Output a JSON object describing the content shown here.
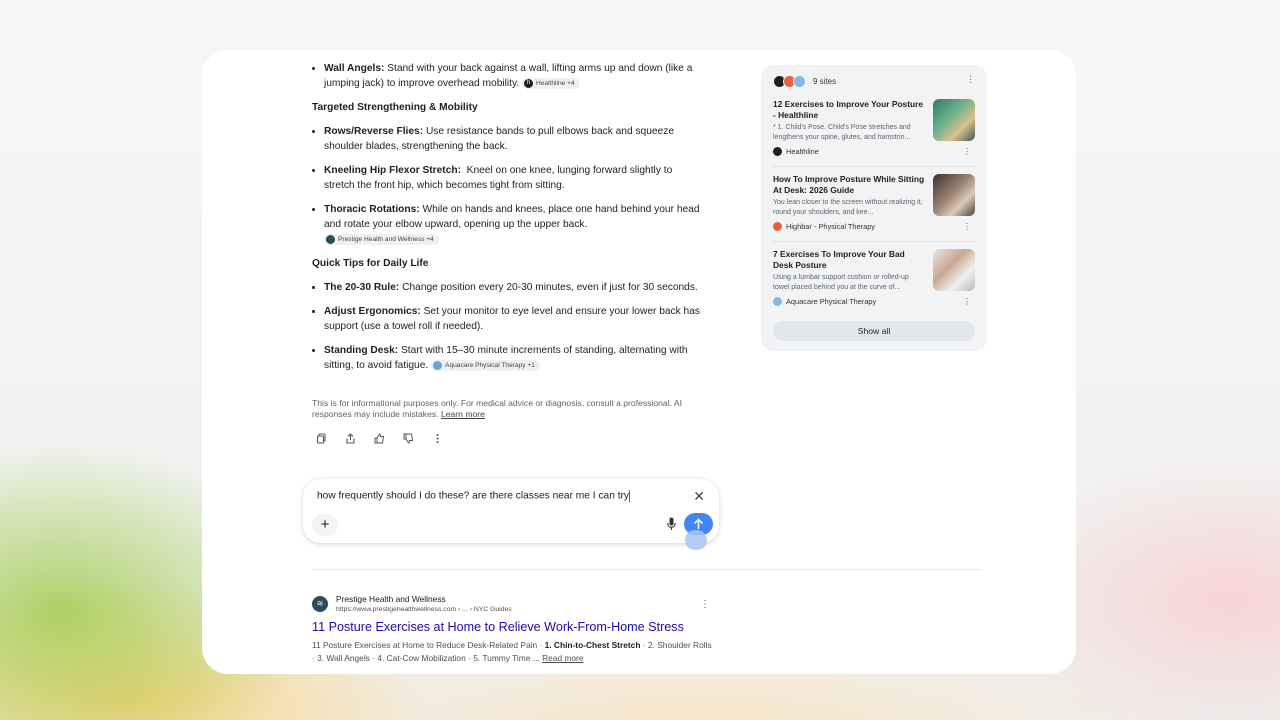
{
  "answer": {
    "wall_angels": {
      "label": "Wall Angels:",
      "text": "Stand with your back against a wall, lifting arms up and down (like a jumping jack) to improve overhead mobility.",
      "chip": "Healthline +4"
    },
    "section2": "Targeted Strengthening & Mobility",
    "rows": {
      "label": "Rows/Reverse Flies:",
      "text": "Use resistance bands to pull elbows back and squeeze shoulder blades, strengthening the back."
    },
    "kneeling": {
      "label": "Kneeling Hip Flexor Stretch:",
      "text": "Kneel on one knee, lunging forward slightly to stretch the front hip, which becomes tight from sitting."
    },
    "thoracic": {
      "label": "Thoracic Rotations:",
      "text": "While on hands and knees, place one hand behind your head and rotate your elbow upward, opening up the upper back.",
      "chip": "Prestige Health and Wellness +4"
    },
    "section3": "Quick Tips for Daily Life",
    "rule": {
      "label": "The 20-30 Rule:",
      "text": "Change position every 20-30 minutes, even if just for 30 seconds."
    },
    "ergonomics": {
      "label": "Adjust Ergonomics:",
      "text": "Set your monitor to eye level and ensure your lower back has support (use a towel roll if needed)."
    },
    "standing": {
      "label": "Standing Desk:",
      "text": "Start with 15–30 minute increments of standing, alternating with sitting, to avoid fatigue.",
      "chip": "Aquacare Physical Therapy +1"
    },
    "disclaimer": "This is for informational purposes only. For medical advice or diagnosis, consult a professional. AI responses may include mistakes.",
    "learn_more": "Learn more"
  },
  "prompt": {
    "text": "how frequently should I do these? are there classes near me I can try",
    "close": "✕",
    "plus": "+"
  },
  "result": {
    "site": "Prestige Health and Wellness",
    "url": "https://www.prestigehealthwellness.com › ... › NYC Guides",
    "title": "11 Posture Exercises at Home to Relieve Work-From-Home Stress",
    "snippet_a": "11 Posture Exercises at Home to Reduce Desk-Related Pain · ",
    "snippet_b": "1. Chin-to-Chest Stretch",
    "snippet_c": " · 2. Shoulder Rolls · 3. Wall Angels · 4. Cat-Cow Mobilization · 5. Tummy Time ... ",
    "read_more": "Read more"
  },
  "sources": {
    "count": "9 sites",
    "items": [
      {
        "title": "12 Exercises to Improve Your Posture - Healthline",
        "desc": "* 1. Child's Pose. Child's Pose stretches and lengthens your spine, glutes, and hamstrin...",
        "name": "Healthline"
      },
      {
        "title": "How To Improve Posture While Sitting At Desk: 2026 Guide",
        "desc": "You lean closer to the screen without realizing it, round your shoulders, and kee...",
        "name": "Highbar - Physical Therapy"
      },
      {
        "title": "7 Exercises To Improve Your Bad Desk Posture",
        "desc": "Using a lumbar support cushion or rolled-up towel placed behind you at the curve of...",
        "name": "Aquacare Physical Therapy"
      }
    ],
    "show_all": "Show all"
  },
  "colors": {
    "accent": "#4285f4",
    "link": "#1a0dab"
  }
}
